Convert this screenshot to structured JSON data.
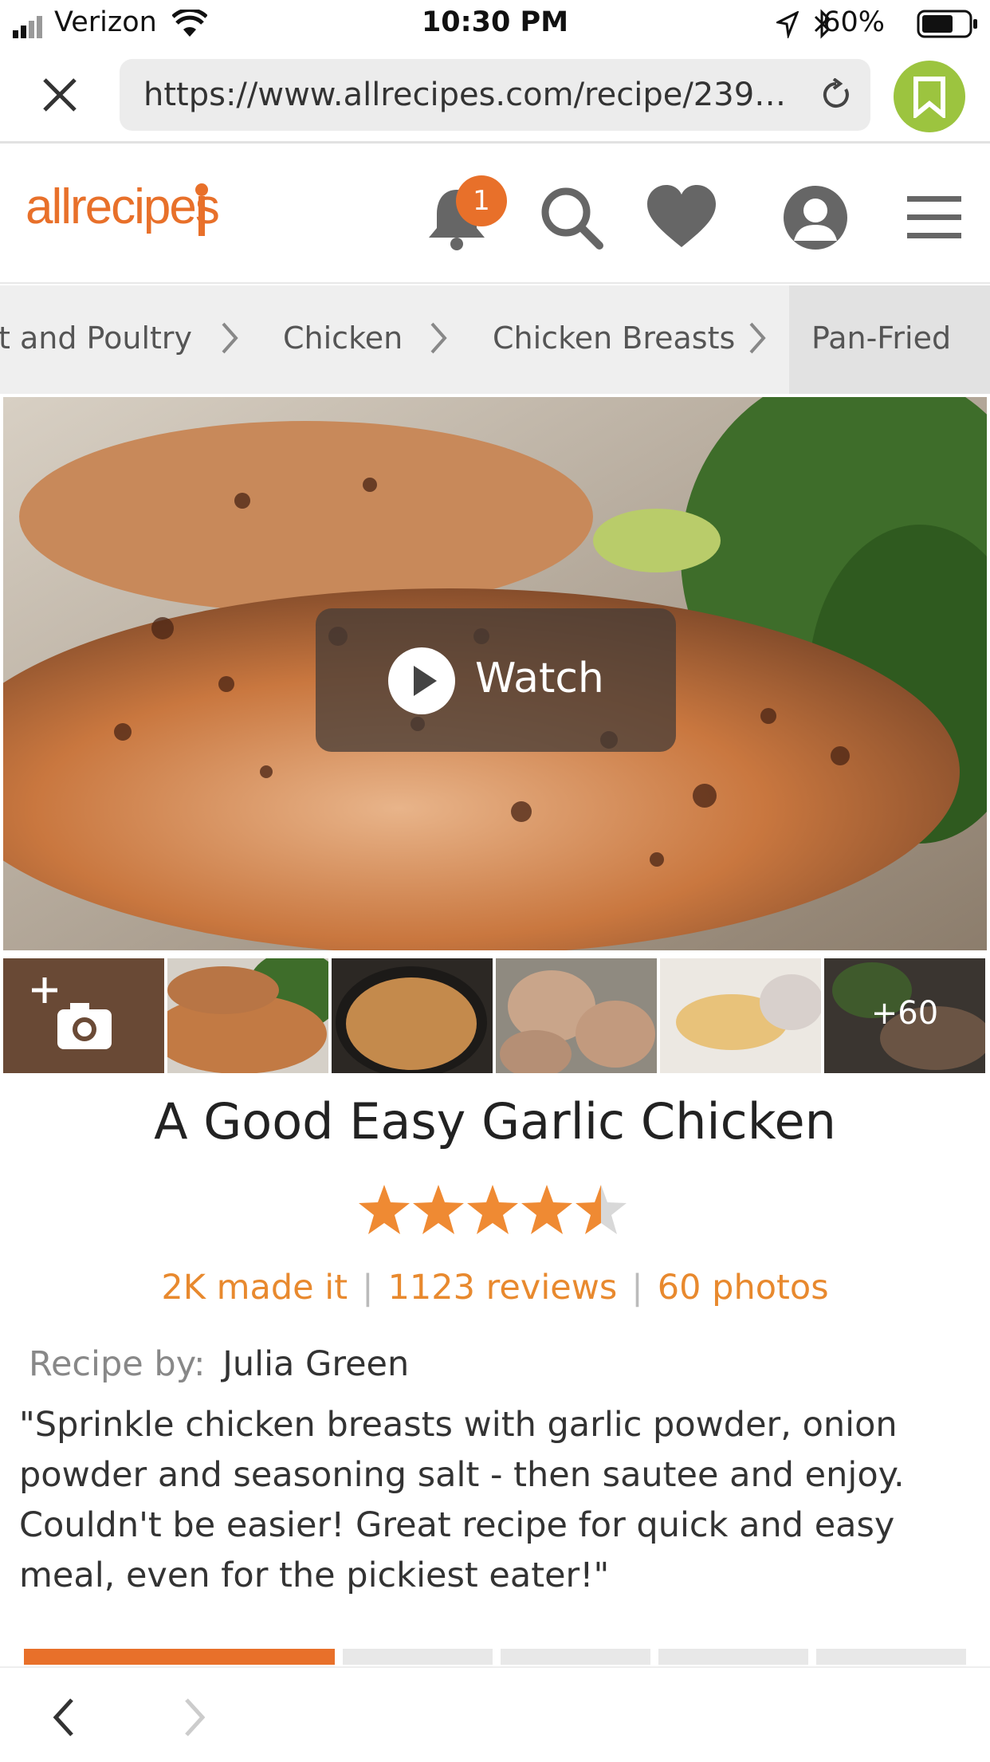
{
  "status_bar": {
    "carrier": "Verizon",
    "time": "10:30 PM",
    "battery": "60%"
  },
  "browser": {
    "url": "https://www.allrecipes.com/recipe/23998/..."
  },
  "site": {
    "logo": "allrecipes",
    "notification_count": "1"
  },
  "breadcrumbs": [
    "t and Poultry",
    "Chicken",
    "Chicken Breasts",
    "Pan-Fried"
  ],
  "hero": {
    "watch_label": "Watch"
  },
  "thumbnails": {
    "more_count": "+60"
  },
  "recipe": {
    "title": "A Good Easy Garlic Chicken",
    "rating": 4.5,
    "made_it": "2K made it",
    "reviews": "1123 reviews",
    "photos": "60 photos",
    "by_label": "Recipe by:",
    "author": "Julia Green",
    "description": "\"Sprinkle chicken breasts with garlic powder, onion powder and seasoning salt - then sautee and enjoy. Couldn't be easier! Great recipe for quick and easy meal, even for the pickiest eater!\""
  },
  "colors": {
    "accent": "#e8702a",
    "bookmark": "#9cc43f"
  }
}
